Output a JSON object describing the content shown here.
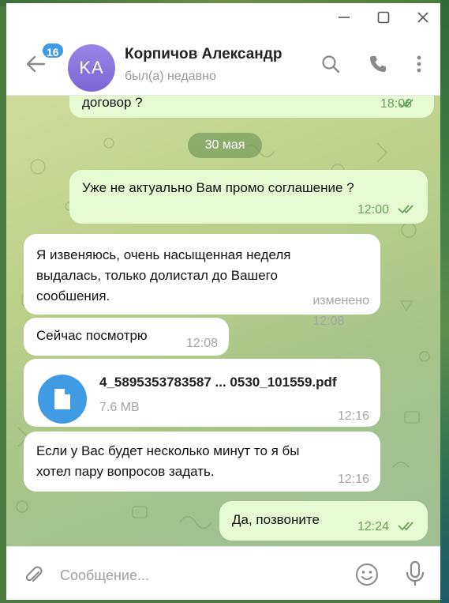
{
  "window": {
    "controls": [
      "minimize-icon",
      "maximize-icon",
      "close-icon"
    ]
  },
  "header": {
    "unread_count": "16",
    "avatar_initials": "KA",
    "contact_name": "Корпичов Александр",
    "status": "был(а) недавно",
    "icons": [
      "back-arrow-icon",
      "search-icon",
      "phone-icon",
      "more-vertical-icon"
    ]
  },
  "chat": {
    "messages_top": {
      "text": "договор ?",
      "time": "18:06",
      "direction": "out"
    },
    "date_separator": "30 мая",
    "messages": [
      {
        "direction": "out",
        "text": "Уже не актуально Вам промо соглашение ?",
        "time": "12:00",
        "read": true
      },
      {
        "direction": "in",
        "lines": [
          "Я извеняюсь, очень насыщенная неделя",
          "выдалась, только долистал до Вашего",
          "сообшения."
        ],
        "time": "изменено 12:08"
      },
      {
        "direction": "in",
        "text": "Сейчас посмотрю",
        "time": "12:08"
      },
      {
        "direction": "in",
        "file_name": "4_5895353783587 ... 0530_101559.pdf",
        "file_size": "7.6 MB",
        "time": "12:16",
        "icon": "file-icon"
      },
      {
        "direction": "in",
        "lines": [
          "Если у Вас будет несколько минут то я бы",
          "хотел пару вопросов задать."
        ],
        "time": "12:16"
      },
      {
        "direction": "out",
        "text": "Да, позвоните",
        "time": "12:24",
        "read": true
      }
    ]
  },
  "composer": {
    "placeholder": "Сообщение...",
    "icons": [
      "attach-icon",
      "emoji-icon",
      "microphone-icon"
    ]
  },
  "colors": {
    "accent": "#3f9be3",
    "outgoing_bubble": "#e7fbd2",
    "incoming_bubble": "#ffffff",
    "outgoing_time": "#64a55b",
    "avatar": "#8a74de"
  }
}
